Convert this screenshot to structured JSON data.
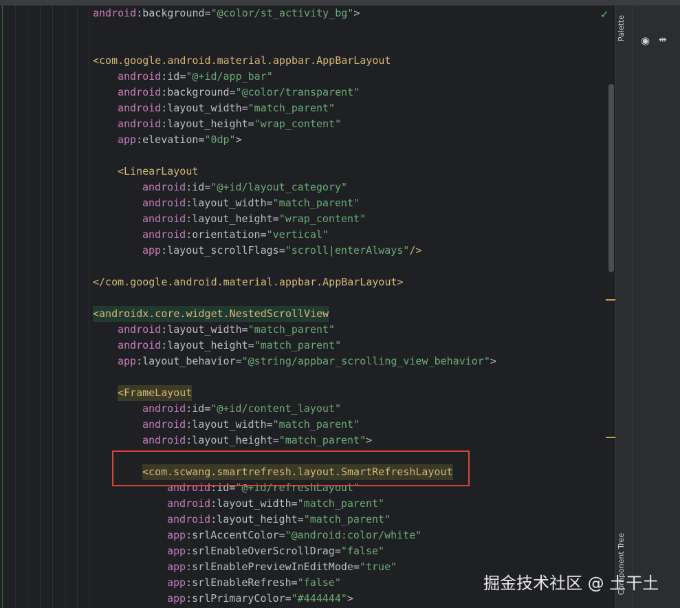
{
  "editor": {
    "status_check": "✓",
    "lines": [
      {
        "indent": 0,
        "segments": [
          [
            "ns",
            "android"
          ],
          [
            "punc",
            ":"
          ],
          [
            "attr",
            "background"
          ],
          [
            "punc",
            "="
          ],
          [
            "val",
            "\"@color/st_activity_bg\""
          ],
          [
            "punc",
            ">"
          ]
        ]
      },
      {
        "indent": 0,
        "segments": []
      },
      {
        "indent": 0,
        "segments": []
      },
      {
        "indent": 0,
        "segments": [
          [
            "tag",
            "<com.google.android.material.appbar.AppBarLayout"
          ]
        ]
      },
      {
        "indent": 1,
        "segments": [
          [
            "ns",
            "android"
          ],
          [
            "punc",
            ":"
          ],
          [
            "attr",
            "id"
          ],
          [
            "punc",
            "="
          ],
          [
            "val",
            "\"@+id/app_bar\""
          ]
        ]
      },
      {
        "indent": 1,
        "segments": [
          [
            "ns",
            "android"
          ],
          [
            "punc",
            ":"
          ],
          [
            "attr",
            "background"
          ],
          [
            "punc",
            "="
          ],
          [
            "val",
            "\"@color/transparent\""
          ]
        ]
      },
      {
        "indent": 1,
        "segments": [
          [
            "ns",
            "android"
          ],
          [
            "punc",
            ":"
          ],
          [
            "attr",
            "layout_width"
          ],
          [
            "punc",
            "="
          ],
          [
            "val",
            "\"match_parent\""
          ]
        ]
      },
      {
        "indent": 1,
        "segments": [
          [
            "ns",
            "android"
          ],
          [
            "punc",
            ":"
          ],
          [
            "attr",
            "layout_height"
          ],
          [
            "punc",
            "="
          ],
          [
            "val",
            "\"wrap_content\""
          ]
        ]
      },
      {
        "indent": 1,
        "segments": [
          [
            "ns",
            "app"
          ],
          [
            "punc",
            ":"
          ],
          [
            "attr",
            "elevation"
          ],
          [
            "punc",
            "="
          ],
          [
            "val",
            "\"0dp\""
          ],
          [
            "punc",
            ">"
          ]
        ]
      },
      {
        "indent": 0,
        "segments": []
      },
      {
        "indent": 1,
        "segments": [
          [
            "tag",
            "<LinearLayout"
          ]
        ]
      },
      {
        "indent": 2,
        "segments": [
          [
            "ns",
            "android"
          ],
          [
            "punc",
            ":"
          ],
          [
            "attr",
            "id"
          ],
          [
            "punc",
            "="
          ],
          [
            "val",
            "\"@+id/layout_category\""
          ]
        ]
      },
      {
        "indent": 2,
        "segments": [
          [
            "ns",
            "android"
          ],
          [
            "punc",
            ":"
          ],
          [
            "attr",
            "layout_width"
          ],
          [
            "punc",
            "="
          ],
          [
            "val",
            "\"match_parent\""
          ]
        ]
      },
      {
        "indent": 2,
        "segments": [
          [
            "ns",
            "android"
          ],
          [
            "punc",
            ":"
          ],
          [
            "attr",
            "layout_height"
          ],
          [
            "punc",
            "="
          ],
          [
            "val",
            "\"wrap_content\""
          ]
        ]
      },
      {
        "indent": 2,
        "segments": [
          [
            "ns",
            "android"
          ],
          [
            "punc",
            ":"
          ],
          [
            "attr",
            "orientation"
          ],
          [
            "punc",
            "="
          ],
          [
            "val",
            "\"vertical\""
          ]
        ]
      },
      {
        "indent": 2,
        "segments": [
          [
            "ns",
            "app"
          ],
          [
            "punc",
            ":"
          ],
          [
            "attr",
            "layout_scrollFlags"
          ],
          [
            "punc",
            "="
          ],
          [
            "val",
            "\"scroll|enterAlways\""
          ],
          [
            "tag",
            "/>"
          ]
        ]
      },
      {
        "indent": 0,
        "segments": []
      },
      {
        "indent": 0,
        "segments": [
          [
            "tag",
            "</com.google.android.material.appbar.AppBarLayout>"
          ]
        ]
      },
      {
        "indent": 0,
        "segments": []
      },
      {
        "indent": 0,
        "hl": "hl-bg",
        "segments": [
          [
            "tag",
            "<androidx.core.widget.NestedScrollView"
          ]
        ]
      },
      {
        "indent": 1,
        "segments": [
          [
            "ns",
            "android"
          ],
          [
            "punc",
            ":"
          ],
          [
            "attr",
            "layout_width"
          ],
          [
            "punc",
            "="
          ],
          [
            "val",
            "\"match_parent\""
          ]
        ]
      },
      {
        "indent": 1,
        "segments": [
          [
            "ns",
            "android"
          ],
          [
            "punc",
            ":"
          ],
          [
            "attr",
            "layout_height"
          ],
          [
            "punc",
            "="
          ],
          [
            "val",
            "\"match_parent\""
          ]
        ]
      },
      {
        "indent": 1,
        "segments": [
          [
            "ns",
            "app"
          ],
          [
            "punc",
            ":"
          ],
          [
            "attr",
            "layout_behavior"
          ],
          [
            "punc",
            "="
          ],
          [
            "val",
            "\"@string/appbar_scrolling_view_behavior\""
          ],
          [
            "punc",
            ">"
          ]
        ]
      },
      {
        "indent": 0,
        "segments": []
      },
      {
        "indent": 1,
        "hl": "hl-yellow",
        "segments": [
          [
            "tag",
            "<FrameLayout"
          ]
        ]
      },
      {
        "indent": 2,
        "segments": [
          [
            "ns",
            "android"
          ],
          [
            "punc",
            ":"
          ],
          [
            "attr",
            "id"
          ],
          [
            "punc",
            "="
          ],
          [
            "val",
            "\"@+id/content_layout\""
          ]
        ]
      },
      {
        "indent": 2,
        "segments": [
          [
            "ns",
            "android"
          ],
          [
            "punc",
            ":"
          ],
          [
            "attr",
            "layout_width"
          ],
          [
            "punc",
            "="
          ],
          [
            "val",
            "\"match_parent\""
          ]
        ]
      },
      {
        "indent": 2,
        "segments": [
          [
            "ns",
            "android"
          ],
          [
            "punc",
            ":"
          ],
          [
            "attr",
            "layout_height"
          ],
          [
            "punc",
            "="
          ],
          [
            "val",
            "\"match_parent\""
          ],
          [
            "punc",
            ">"
          ]
        ]
      },
      {
        "indent": 0,
        "segments": []
      },
      {
        "indent": 2,
        "hl": "hl-yellow",
        "segments": [
          [
            "tag",
            "<com.scwang.smartrefresh.layout.SmartRefreshLayout"
          ]
        ]
      },
      {
        "indent": 3,
        "segments": [
          [
            "ns",
            "android"
          ],
          [
            "punc",
            ":"
          ],
          [
            "attr",
            "id"
          ],
          [
            "punc",
            "="
          ],
          [
            "val",
            "\"@+id/refreshLayout\""
          ]
        ]
      },
      {
        "indent": 3,
        "segments": [
          [
            "ns",
            "android"
          ],
          [
            "punc",
            ":"
          ],
          [
            "attr",
            "layout_width"
          ],
          [
            "punc",
            "="
          ],
          [
            "val",
            "\"match_parent\""
          ]
        ]
      },
      {
        "indent": 3,
        "segments": [
          [
            "ns",
            "android"
          ],
          [
            "punc",
            ":"
          ],
          [
            "attr",
            "layout_height"
          ],
          [
            "punc",
            "="
          ],
          [
            "val",
            "\"match_parent\""
          ]
        ]
      },
      {
        "indent": 3,
        "segments": [
          [
            "ns",
            "app"
          ],
          [
            "punc",
            ":"
          ],
          [
            "attr",
            "srlAccentColor"
          ],
          [
            "punc",
            "="
          ],
          [
            "val",
            "\"@android:color/white\""
          ]
        ]
      },
      {
        "indent": 3,
        "segments": [
          [
            "ns",
            "app"
          ],
          [
            "punc",
            ":"
          ],
          [
            "attr",
            "srlEnableOverScrollDrag"
          ],
          [
            "punc",
            "="
          ],
          [
            "val",
            "\"false\""
          ]
        ]
      },
      {
        "indent": 3,
        "segments": [
          [
            "ns",
            "app"
          ],
          [
            "punc",
            ":"
          ],
          [
            "attr",
            "srlEnablePreviewInEditMode"
          ],
          [
            "punc",
            "="
          ],
          [
            "val",
            "\"true\""
          ]
        ]
      },
      {
        "indent": 3,
        "segments": [
          [
            "ns",
            "app"
          ],
          [
            "punc",
            ":"
          ],
          [
            "attr",
            "srlEnableRefresh"
          ],
          [
            "punc",
            "="
          ],
          [
            "val",
            "\"false\""
          ]
        ]
      },
      {
        "indent": 3,
        "segments": [
          [
            "ns",
            "app"
          ],
          [
            "punc",
            ":"
          ],
          [
            "attr",
            "srlPrimaryColor"
          ],
          [
            "punc",
            "="
          ],
          [
            "val",
            "\"#444444\""
          ],
          [
            "punc",
            ">"
          ]
        ]
      }
    ]
  },
  "side": {
    "palette_label": "Palette",
    "component_tree_label": "Component Tree"
  },
  "watermark": "掘金技术社区 @ 土干土",
  "colors": {
    "background": "#1f2023",
    "tag": "#d5b778",
    "namespace": "#c77dbb",
    "value": "#6aab73",
    "highlight_box": "#d9443b"
  }
}
